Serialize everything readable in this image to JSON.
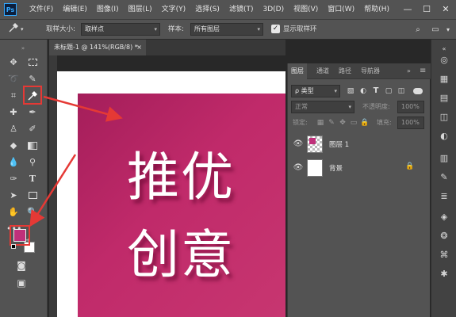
{
  "menubar": {
    "logo": "Ps",
    "items": [
      "文件(F)",
      "编辑(E)",
      "图像(I)",
      "图层(L)",
      "文字(Y)",
      "选择(S)",
      "滤镜(T)",
      "3D(D)",
      "视图(V)",
      "窗口(W)",
      "帮助(H)"
    ],
    "minimize": "—",
    "maximize": "☐",
    "close": "✕"
  },
  "options": {
    "sample_size_label": "取样大小:",
    "sample_size_value": "取样点",
    "sample_label": "样本:",
    "sample_value": "所有图层",
    "show_ring_label": "显示取样环"
  },
  "document": {
    "tab_title": "未标题-1 @ 141%(RGB/8) *",
    "tab_close": "×",
    "text_line1": "推优",
    "text_line2": "创意"
  },
  "layers_panel": {
    "tabs": [
      "图层",
      "通道",
      "路径",
      "导航器"
    ],
    "filter_label": "ρ 类型",
    "blend_mode": "正常",
    "opacity_label": "不透明度:",
    "opacity_value": "100%",
    "lock_label": "锁定:",
    "fill_label": "填充:",
    "fill_value": "100%",
    "layers": [
      {
        "name": "图层 1"
      },
      {
        "name": "背景"
      }
    ]
  },
  "colors": {
    "foreground": "#c0307a",
    "background": "#ffffff",
    "canvas_magenta": "#b8256a",
    "highlight": "#e53935"
  }
}
